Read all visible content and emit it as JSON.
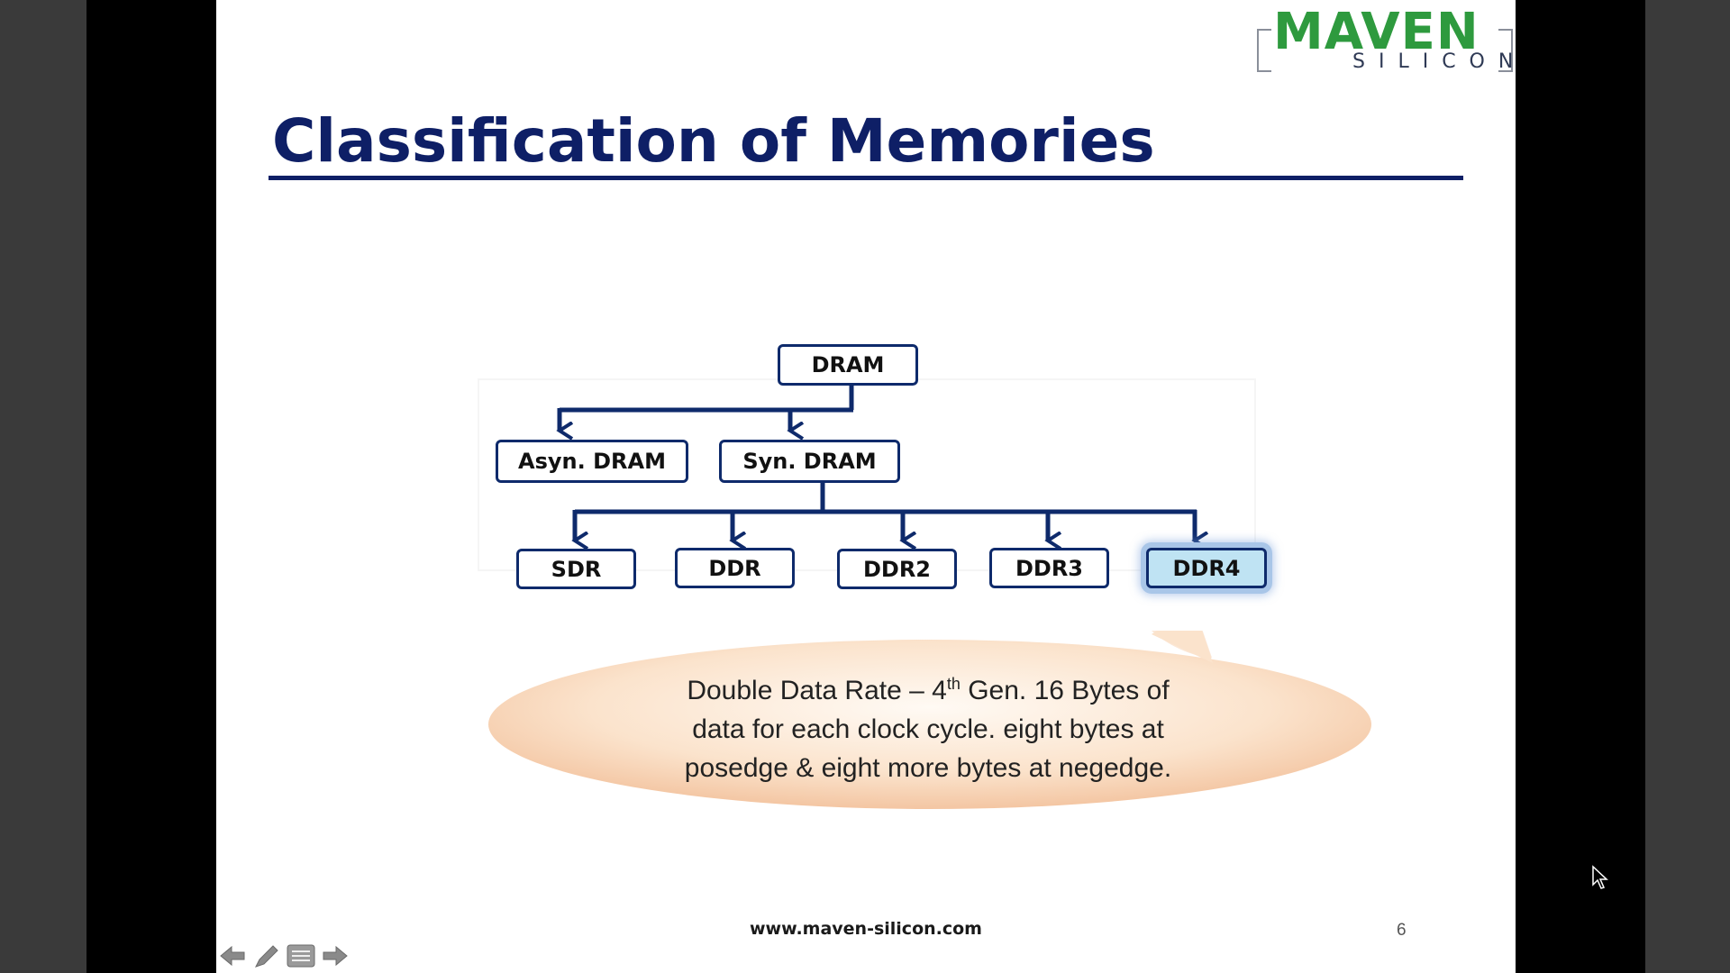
{
  "slide": {
    "title": "Classification of Memories",
    "logo": {
      "main": "MAVEN",
      "sub": "SILICON"
    },
    "footer_url": "www.maven-silicon.com",
    "page_number": "6"
  },
  "diagram": {
    "root": "DRAM",
    "level1": [
      "Asyn. DRAM",
      "Syn. DRAM"
    ],
    "level2": [
      "SDR",
      "DDR",
      "DDR2",
      "DDR3",
      "DDR4"
    ],
    "highlighted": "DDR4"
  },
  "callout": {
    "line1_a": "Double Data Rate – 4",
    "line1_sup": "th",
    "line1_b": " Gen. 16 Bytes of",
    "line2": "data for each clock cycle. eight bytes at",
    "line3": "posedge & eight more bytes at negedge."
  },
  "controls": {
    "icons": [
      "arrow-left-icon",
      "pen-icon",
      "menu-icon",
      "arrow-right-icon"
    ]
  }
}
